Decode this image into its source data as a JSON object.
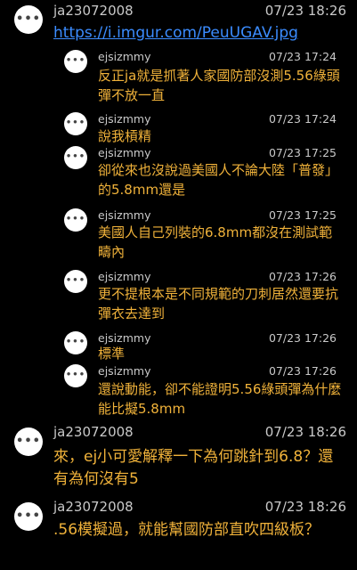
{
  "comments": [
    {
      "kind": "top",
      "user": "ja23072008",
      "time": "07/23 18:26",
      "text": "https://i.imgur.com/PeuUGAV.jpg",
      "is_link": true
    },
    {
      "kind": "reply",
      "user": "ejsizmmy",
      "time": "07/23 17:24",
      "text": "反正ja就是抓著人家國防部沒測5.56綠頭彈不放一直"
    },
    {
      "kind": "reply",
      "user": "ejsizmmy",
      "time": "07/23 17:24",
      "text": "說我槓精"
    },
    {
      "kind": "reply",
      "user": "ejsizmmy",
      "time": "07/23 17:25",
      "text": "卻從來也沒說過美國人不論大陸「普發」的5.8mm還是"
    },
    {
      "kind": "reply",
      "user": "ejsizmmy",
      "time": "07/23 17:25",
      "text": "美國人自己列裝的6.8mm都沒在測試範疇內"
    },
    {
      "kind": "reply",
      "user": "ejsizmmy",
      "time": "07/23 17:26",
      "text": "更不提根本是不同規範的刀刺居然還要抗彈衣去達到"
    },
    {
      "kind": "reply",
      "user": "ejsizmmy",
      "time": "07/23 17:26",
      "text": "標準"
    },
    {
      "kind": "reply",
      "user": "ejsizmmy",
      "time": "07/23 17:26",
      "text": "還說動能，卻不能證明5.56綠頭彈為什麼能比擬5.8mm"
    },
    {
      "kind": "top",
      "user": "ja23072008",
      "time": "07/23 18:26",
      "text": "來，ej小可愛解釋一下為何跳針到6.8？還有為何沒有5"
    },
    {
      "kind": "top",
      "user": "ja23072008",
      "time": "07/23 18:26",
      "text": ".56模擬過，就能幫國防部直吹四級板？"
    }
  ]
}
